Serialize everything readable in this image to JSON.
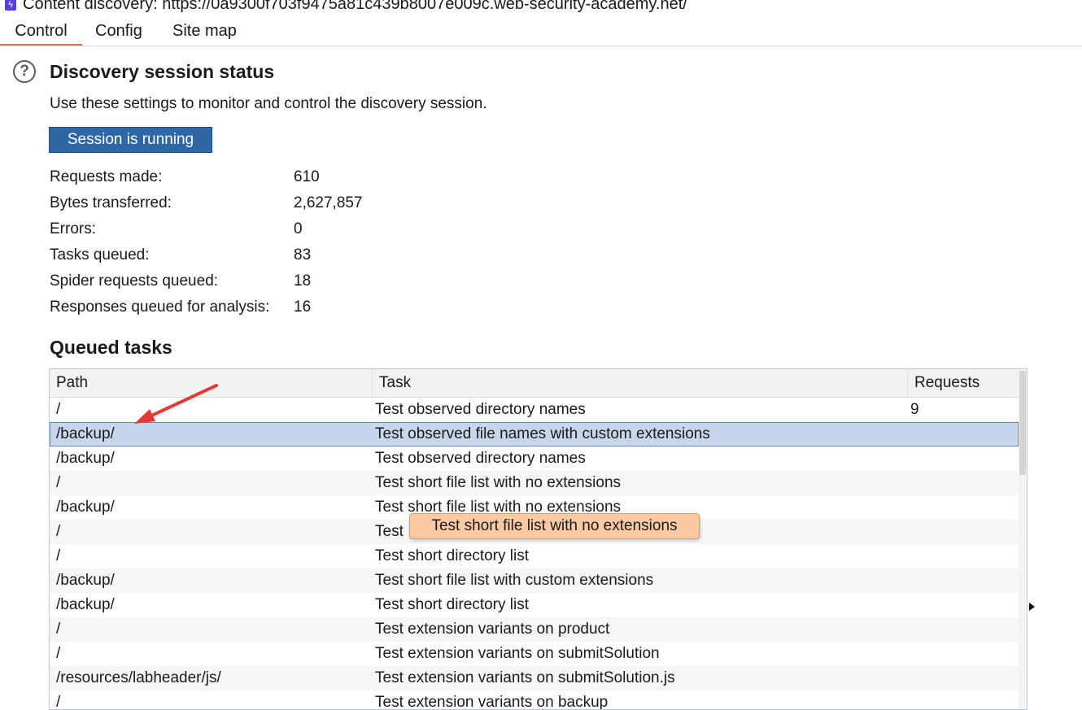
{
  "window": {
    "title": "Content discovery: https://0a9300f703f9475a81c439b8007e009c.web-security-academy.net/",
    "icon": "burp-app-icon"
  },
  "tabs": [
    {
      "label": "Control",
      "active": true
    },
    {
      "label": "Config",
      "active": false
    },
    {
      "label": "Site map",
      "active": false
    }
  ],
  "section": {
    "icon": "help-icon",
    "title": "Discovery session status",
    "description": "Use these settings to monitor and control the discovery session.",
    "status_button": "Session is running"
  },
  "stats": [
    {
      "label": "Requests made:",
      "value": "610"
    },
    {
      "label": "Bytes transferred:",
      "value": "2,627,857"
    },
    {
      "label": "Errors:",
      "value": "0"
    },
    {
      "label": "Tasks queued:",
      "value": "83"
    },
    {
      "label": "Spider requests queued:",
      "value": "18"
    },
    {
      "label": "Responses queued for analysis:",
      "value": "16"
    }
  ],
  "queued_tasks": {
    "title": "Queued tasks",
    "columns": [
      "Path",
      "Task",
      "Requests"
    ],
    "rows": [
      {
        "path": "/",
        "task": "Test observed directory names",
        "requests": "9"
      },
      {
        "path": "/backup/",
        "task": "Test observed file names with custom extensions",
        "requests": ""
      },
      {
        "path": "/backup/",
        "task": "Test observed directory names",
        "requests": ""
      },
      {
        "path": "/",
        "task": "Test short file list with no extensions",
        "requests": ""
      },
      {
        "path": "/backup/",
        "task": "Test short file list with no extensions",
        "requests": ""
      },
      {
        "path": "/",
        "task": "Test",
        "requests": ""
      },
      {
        "path": "/",
        "task": "Test short directory list",
        "requests": ""
      },
      {
        "path": "/backup/",
        "task": "Test short file list with custom extensions",
        "requests": ""
      },
      {
        "path": "/backup/",
        "task": "Test short directory list",
        "requests": ""
      },
      {
        "path": "/",
        "task": "Test extension variants on product",
        "requests": ""
      },
      {
        "path": "/",
        "task": "Test extension variants on submitSolution",
        "requests": ""
      },
      {
        "path": "/resources/labheader/js/",
        "task": "Test extension variants on submitSolution.js",
        "requests": ""
      },
      {
        "path": "/",
        "task": "Test extension variants on backup",
        "requests": ""
      }
    ],
    "selected_row": 1
  },
  "tooltip": "Test short file list with no extensions",
  "colors": {
    "accent_tab": "#e8703a",
    "status_button": "#2f67a6",
    "selected_row": "#c7d6ea",
    "tooltip_bg": "#fbc9a2",
    "annotation_arrow": "#e53935"
  }
}
